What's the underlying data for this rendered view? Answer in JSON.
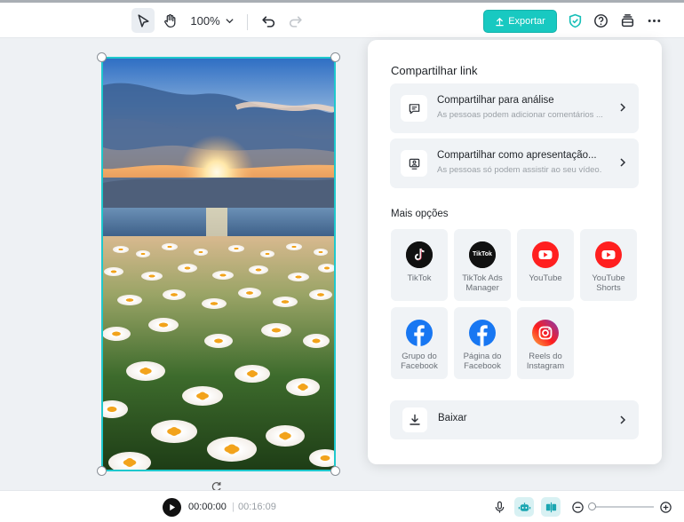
{
  "toolbar": {
    "zoom": "100%",
    "export_label": "Exportar"
  },
  "share_panel": {
    "title": "Compartilhar link",
    "share_items": [
      {
        "title": "Compartilhar para análise",
        "subtitle": "As pessoas podem adicionar comentários ..."
      },
      {
        "title": "Compartilhar como apresentação...",
        "subtitle": "As pessoas só podem assistir ao seu vídeo."
      }
    ],
    "more_options_title": "Mais opções",
    "options": [
      {
        "label": "TikTok",
        "icon": "tiktok-icon",
        "logo_text": ""
      },
      {
        "label": "TikTok Ads\nManager",
        "icon": "tiktok-ads-icon",
        "logo_text": "TikTok"
      },
      {
        "label": "YouTube",
        "icon": "youtube-icon",
        "logo_text": ""
      },
      {
        "label": "YouTube\nShorts",
        "icon": "youtube-shorts-icon",
        "logo_text": ""
      },
      {
        "label": "Grupo do\nFacebook",
        "icon": "facebook-icon",
        "logo_text": ""
      },
      {
        "label": "Página do\nFacebook",
        "icon": "facebook-icon",
        "logo_text": ""
      },
      {
        "label": "Reels do\nInstagram",
        "icon": "instagram-icon",
        "logo_text": ""
      }
    ],
    "download_label": "Baixar"
  },
  "player": {
    "current_time": "00:00:00",
    "separator": "|",
    "total_time": "00:16:09"
  },
  "colors": {
    "accent": "#18c9c1",
    "selection_border": "#1fc8cd",
    "youtube_red": "#ff1f1f",
    "facebook_blue": "#1877f2"
  }
}
